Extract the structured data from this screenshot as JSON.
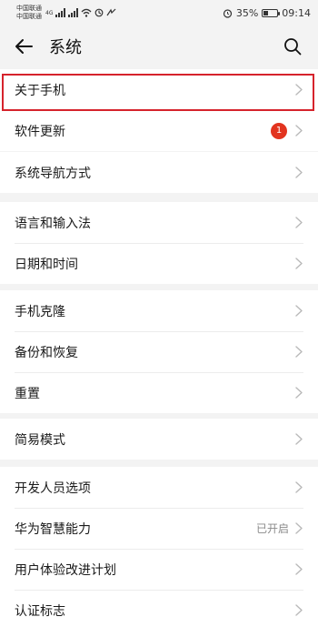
{
  "status_bar": {
    "carrier1": "中国联通",
    "carrier2": "中国联通",
    "network_label": "4G",
    "battery_percent": "35%",
    "battery_level": 0.35,
    "time": "09:14"
  },
  "app_bar": {
    "title": "系统"
  },
  "groups": [
    {
      "items": [
        {
          "label": "关于手机"
        },
        {
          "label": "软件更新",
          "badge": "1"
        }
      ]
    },
    {
      "items": [
        {
          "label": "系统导航方式"
        }
      ]
    },
    {
      "items": [
        {
          "label": "语言和输入法"
        },
        {
          "label": "日期和时间"
        }
      ]
    },
    {
      "items": [
        {
          "label": "手机克隆"
        },
        {
          "label": "备份和恢复"
        },
        {
          "label": "重置"
        }
      ]
    },
    {
      "items": [
        {
          "label": "简易模式"
        }
      ]
    },
    {
      "items": [
        {
          "label": "开发人员选项"
        },
        {
          "label": "华为智慧能力",
          "value": "已开启"
        },
        {
          "label": "用户体验改进计划"
        },
        {
          "label": "认证标志"
        }
      ]
    }
  ],
  "colors": {
    "background": "#f3f3f3",
    "badge": "#e2341f",
    "highlight": "#d6232c"
  }
}
